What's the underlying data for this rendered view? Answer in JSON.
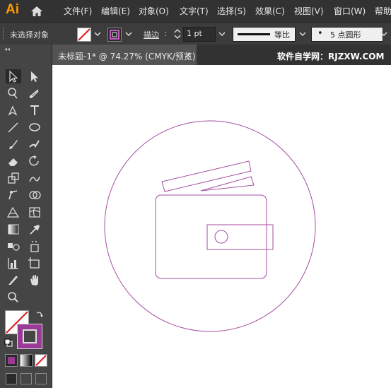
{
  "app": {
    "logo": "Ai"
  },
  "menu": [
    "文件(F)",
    "编辑(E)",
    "对象(O)",
    "文字(T)",
    "选择(S)",
    "效果(C)",
    "视图(V)",
    "窗口(W)",
    "帮助"
  ],
  "control_bar": {
    "selection_status": "未选择对象",
    "stroke_label": "描边",
    "stroke_colon": ":",
    "stroke_weight": "1 pt",
    "stroke_style_label": "等比",
    "brush_bullet": "•",
    "brush_label": "5 点圆形"
  },
  "document": {
    "tab_title": "未标题-1* @ 74.27% (CMYK/预览)",
    "close_glyph": "×",
    "watermark": "软件自学网：RJZXW.COM"
  },
  "toolbar": {
    "collapse_glyph": "◂◂",
    "tools": [
      "selection-tool",
      "direct-selection-tool",
      "magic-wand-tool",
      "lasso-tool",
      "pen-tool",
      "type-tool",
      "line-tool",
      "ellipse-tool",
      "paintbrush-tool",
      "blob-brush-tool",
      "eraser-tool",
      "rotate-tool",
      "scale-tool",
      "warp-tool",
      "free-transform-tool",
      "shape-builder-tool",
      "perspective-grid-tool",
      "mesh-tool",
      "gradient-tool",
      "eyedropper-tool",
      "blend-tool",
      "symbol-sprayer-tool",
      "column-graph-tool",
      "artboard-tool",
      "slice-tool",
      "hand-tool",
      "zoom-tool"
    ]
  },
  "colors": {
    "accent_purple": "#9b3a96",
    "stroke_line": "#a44ea0",
    "logo_orange": "#ff9a00",
    "panel_dark": "#323232",
    "panel_mid": "#454545"
  }
}
